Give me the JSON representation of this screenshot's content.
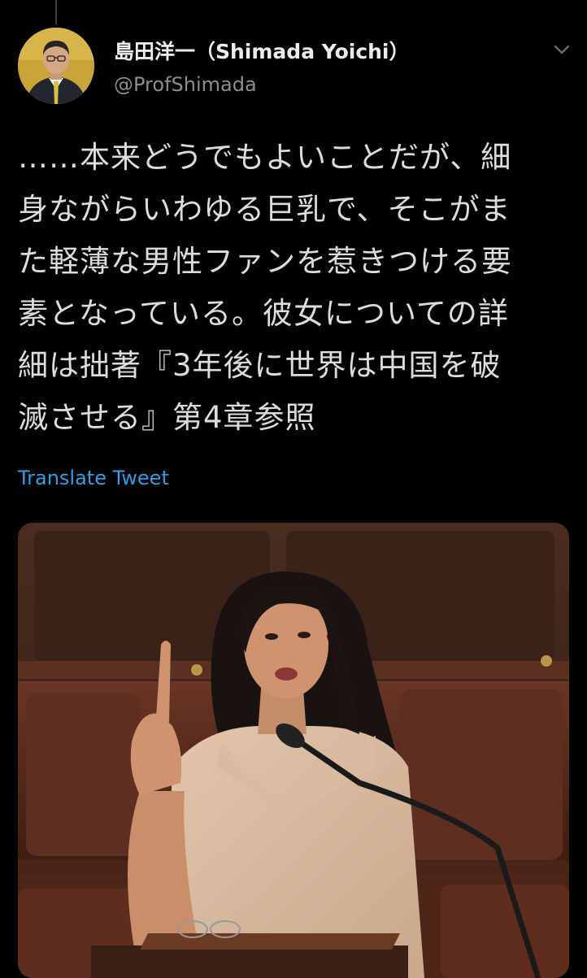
{
  "tweet": {
    "display_name": "島田洋一（Shimada Yoichi）",
    "handle": "@ProfShimada",
    "text_lines": [
      "……本来どうでもよいことだが、細",
      "身ながらいわゆる巨乳で、そこがま",
      "た軽薄な男性ファンを惹きつける要",
      "素となっている。彼女についての詳",
      "細は拙著『3年後に世界は中国を破",
      "滅させる』第4章参照"
    ],
    "translate_label": "Translate Tweet"
  },
  "icons": {
    "menu": "chevron-down-icon"
  },
  "colors": {
    "background": "#000000",
    "link": "#2f9ee8",
    "secondary_text": "#8b8f94"
  }
}
